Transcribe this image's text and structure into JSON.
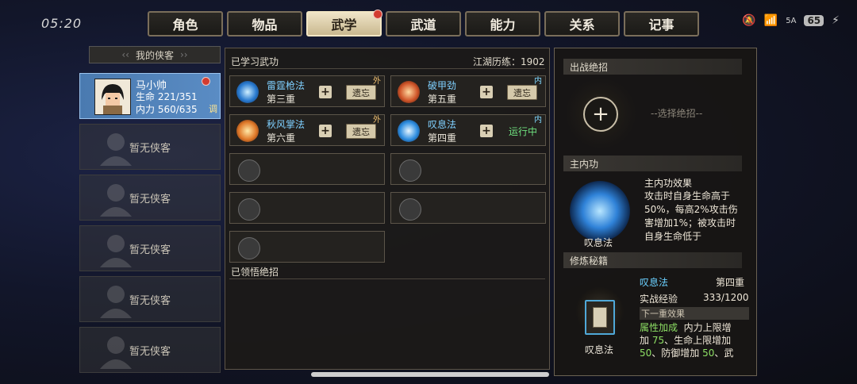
{
  "status": {
    "time": "05:20",
    "battery": "65",
    "network": "5A"
  },
  "tabs": [
    {
      "label": "角色",
      "active": false,
      "badge": false
    },
    {
      "label": "物品",
      "active": false,
      "badge": false
    },
    {
      "label": "武学",
      "active": true,
      "badge": true
    },
    {
      "label": "武道",
      "active": false,
      "badge": false
    },
    {
      "label": "能力",
      "active": false,
      "badge": false
    },
    {
      "label": "关系",
      "active": false,
      "badge": false
    },
    {
      "label": "记事",
      "active": false,
      "badge": false
    }
  ],
  "roster": {
    "title": "我的侠客",
    "hero": {
      "name": "马小帅",
      "hp_label": "生命",
      "hp": "221/351",
      "mp_label": "内力",
      "mp": "560/635",
      "tune": "调"
    },
    "empty_label": "暂无侠客"
  },
  "skills": {
    "learned_title": "已学习武功",
    "exp_label": "江湖历练",
    "exp_value": "1902",
    "cards": [
      {
        "name": "雷霆枪法",
        "level": "第三重",
        "tag": "外",
        "tag_type": "out",
        "action": "遗忘"
      },
      {
        "name": "破甲劲",
        "level": "第五重",
        "tag": "内",
        "tag_type": "in",
        "action": "遗忘"
      },
      {
        "name": "秋风掌法",
        "level": "第六重",
        "tag": "外",
        "tag_type": "out",
        "action": "遗忘"
      },
      {
        "name": "叹息法",
        "level": "第四重",
        "tag": "内",
        "tag_type": "in",
        "status": "运行中"
      }
    ],
    "comprehend_title": "已领悟绝招"
  },
  "right": {
    "ult_title": "出战绝招",
    "ult_placeholder": "--选择绝招--",
    "inner_title": "主内功",
    "inner_effect_title": "主内功效果",
    "inner_effect_lines": [
      "攻击时自身生命高于",
      "50%，每高2%攻击伤",
      "害增加1%；被攻击时",
      "自身生命低于"
    ],
    "inner_name": "叹息法",
    "manual_title": "修炼秘籍",
    "manual_skill": "叹息法",
    "manual_level": "第四重",
    "combat_exp_label": "实战经验",
    "combat_exp_value": "333/1200",
    "next_effect_title": "下一重效果",
    "attr_label": "属性加成",
    "attr_line1": "内力上限增",
    "attr_line2a": "加",
    "attr_v1": "75",
    "attr_line2b": "、生命上限增加",
    "attr_v2": "50",
    "attr_line3a": "、防御增加",
    "attr_v3": "50",
    "attr_line3b": "、武",
    "manual_book": "叹息法"
  }
}
